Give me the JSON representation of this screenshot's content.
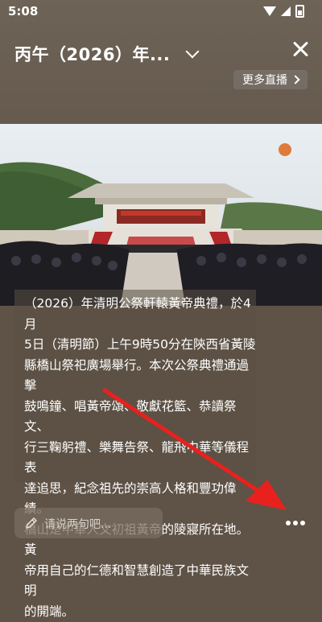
{
  "status_bar": {
    "time": "5:08"
  },
  "header": {
    "title": "丙午（2026）年...",
    "more_live_label": "更多直播"
  },
  "description": "（2026）年清明公祭軒轅黃帝典禮，於4月\n5日（清明節）上午9時50分在陝西省黃陵\n縣橋山祭祀廣場舉行。本次公祭典禮通過擊\n鼓鳴鐘、唱黃帝頌、敬獻花籃、恭讀祭文、\n行三鞠躬禮、樂舞告祭、龍飛中華等儀程表\n達追思，紀念祖先的崇高人格和豐功偉績。\n橋山是中華人文初祖黃帝的陵寢所在地。黃\n帝用自己的仁德和智慧創造了中華民族文明\n的開端。",
  "comment_input": {
    "placeholder": "请说两句吧..."
  },
  "colors": {
    "annotation_arrow": "#e8211f"
  },
  "icons": [
    "chevron-down-icon",
    "close-icon",
    "chevron-right-icon",
    "pencil-icon",
    "more-dots-icon",
    "wifi-icon",
    "signal-icon",
    "battery-icon"
  ]
}
